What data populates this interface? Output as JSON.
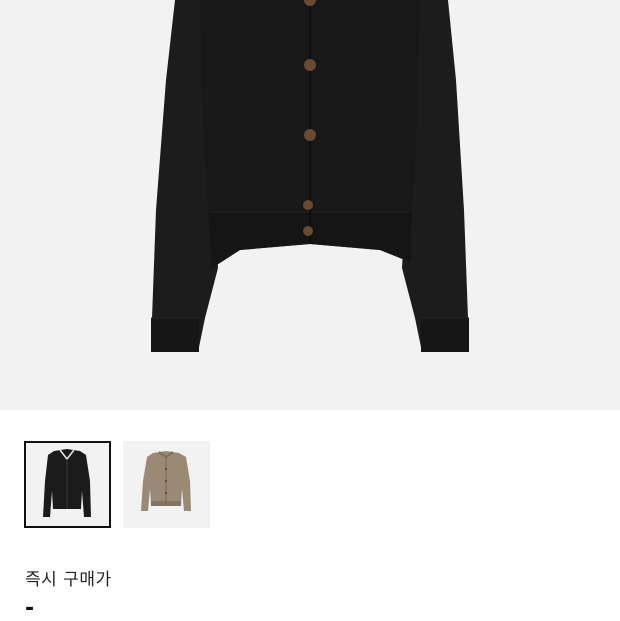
{
  "product": {
    "main_image_icon": "black-knit-cardigan-image",
    "thumbnails": [
      {
        "icon": "black-cardigan-thumbnail",
        "color": "#1b1b1b",
        "selected": true
      },
      {
        "icon": "beige-cardigan-thumbnail",
        "color": "#9a8a74",
        "selected": false
      }
    ]
  },
  "purchase": {
    "instant_price_label": "즉시 구매가",
    "instant_price_value": "-"
  },
  "colors": {
    "hero_background": "#f2f2f2",
    "garment": "#1a1a1a",
    "button": "#6b4a32"
  }
}
